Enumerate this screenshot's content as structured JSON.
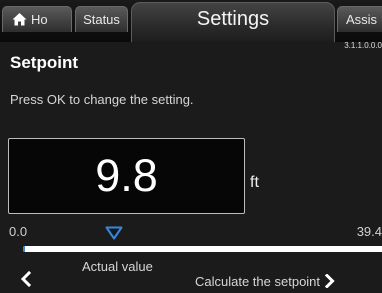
{
  "tabs": {
    "home": "Ho",
    "status": "Status",
    "settings": "Settings",
    "assist": "Assis"
  },
  "version": "3.1.1.0.0.0",
  "screen": {
    "title": "Setpoint",
    "instruction": "Press OK to change the setting."
  },
  "setpoint": {
    "value": "9.8",
    "unit": "ft"
  },
  "scale": {
    "min": "0.0",
    "max": "39.4",
    "actual_fraction": 0.005,
    "marker_fraction": 0.25
  },
  "labels": {
    "actual_value": "Actual value",
    "calculate": "Calculate the setpoint"
  },
  "colors": {
    "marker": "#3d86d4",
    "track": "#ffffff",
    "fill": "#3f86cf"
  },
  "icons": {
    "home": "home-icon",
    "back": "chevron-left-icon",
    "forward": "chevron-right-icon",
    "marker": "triangle-down-icon"
  }
}
